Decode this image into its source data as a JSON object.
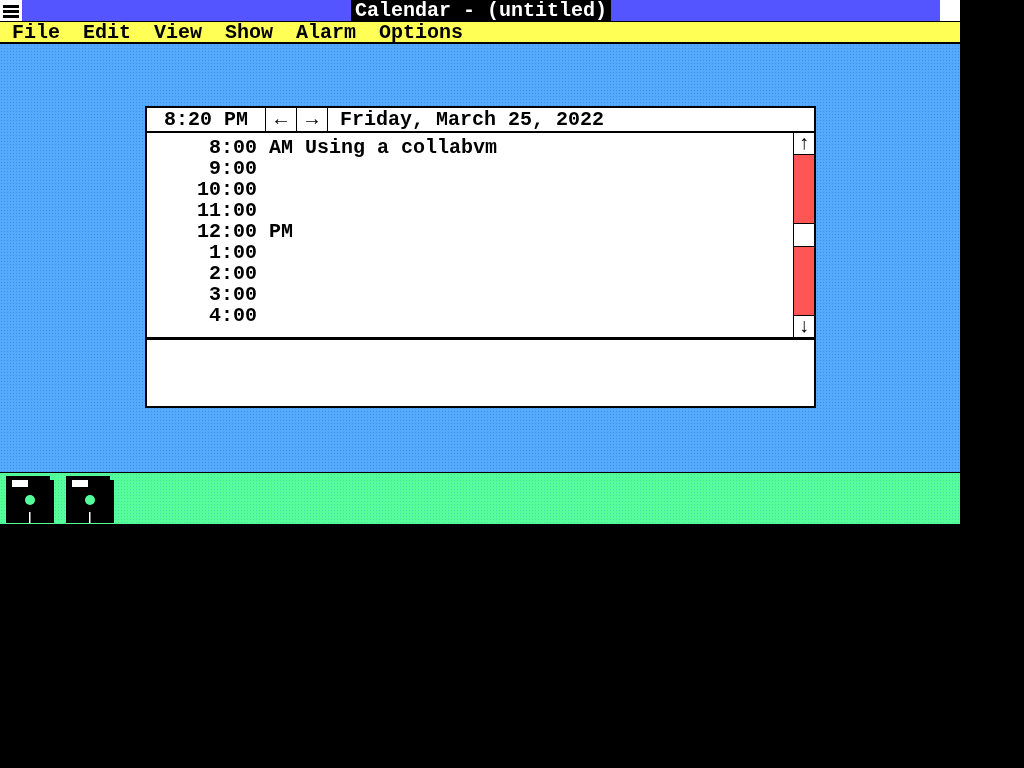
{
  "window": {
    "title": "Calendar - (untitled)"
  },
  "menu": [
    "File",
    "Edit",
    "View",
    "Show",
    "Alarm",
    "Options"
  ],
  "calendar": {
    "current_time": "8:20 PM",
    "prev_button": "←",
    "next_button": "→",
    "date": "Friday, March 25, 2022",
    "appointments": [
      {
        "time": "8:00",
        "meridiem": "AM",
        "note": "Using a collabvm"
      },
      {
        "time": "9:00"
      },
      {
        "time": "10:00"
      },
      {
        "time": "11:00"
      },
      {
        "time": "12:00",
        "meridiem": "PM"
      },
      {
        "time": "1:00"
      },
      {
        "time": "2:00"
      },
      {
        "time": "3:00"
      },
      {
        "time": "4:00"
      }
    ],
    "scroll_up": "↑",
    "scroll_down": "↓"
  },
  "icon_area": {
    "icons": [
      {
        "kind": "disk"
      },
      {
        "kind": "disk"
      }
    ]
  }
}
